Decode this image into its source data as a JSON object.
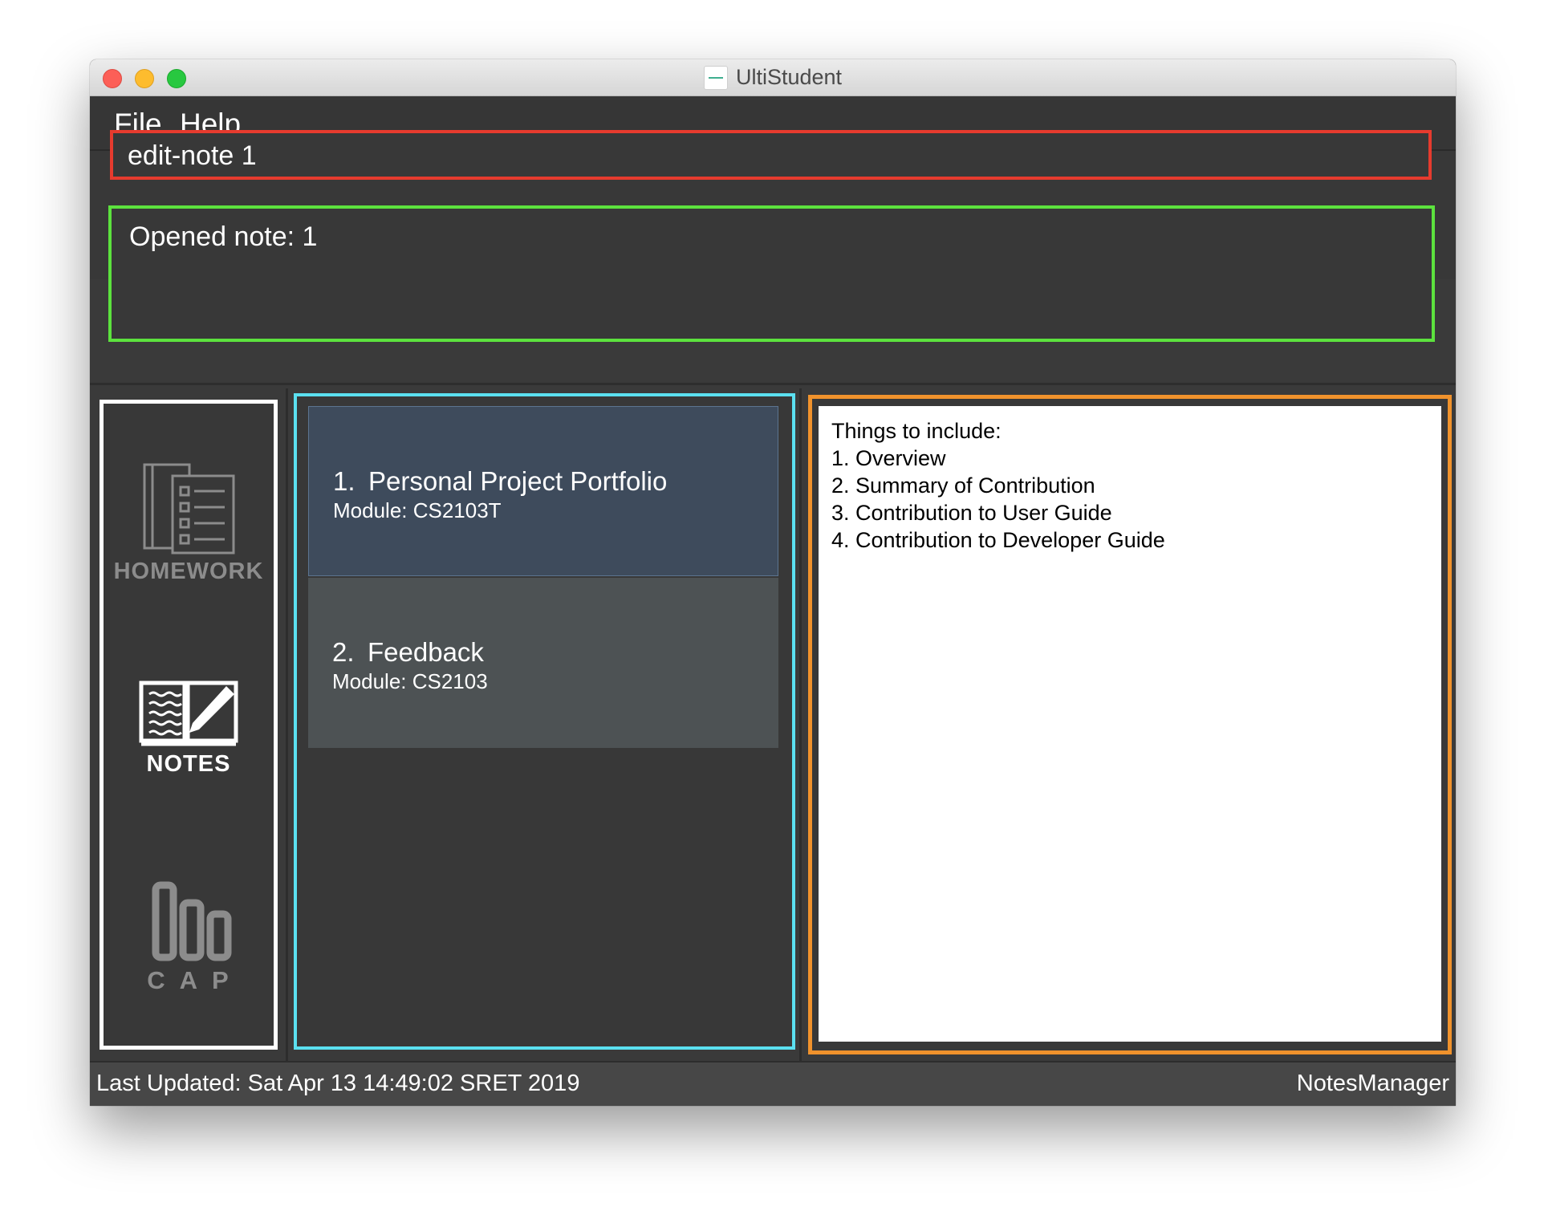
{
  "window": {
    "title": "UltiStudent"
  },
  "menu": {
    "file": "File",
    "help": "Help"
  },
  "command": {
    "value": "edit-note 1"
  },
  "result": {
    "message": "Opened note: 1"
  },
  "sidebar": {
    "items": [
      {
        "label": "HOMEWORK",
        "icon": "homework-icon",
        "active": false
      },
      {
        "label": "NOTES",
        "icon": "notes-icon",
        "active": true
      },
      {
        "label": "CAP",
        "icon": "cap-icon",
        "active": false
      }
    ]
  },
  "notes": [
    {
      "index": "1.",
      "title": "Personal Project Portfolio",
      "module": "Module: CS2103T",
      "selected": true
    },
    {
      "index": "2.",
      "title": "Feedback",
      "module": "Module: CS2103",
      "selected": false
    }
  ],
  "detail": {
    "lines": [
      "Things to include:",
      "1. Overview",
      "2. Summary of Contribution",
      "3. Contribution to User Guide",
      "4. Contribution to Developer Guide"
    ]
  },
  "status": {
    "last_updated": "Last Updated: Sat Apr 13 14:49:02 SRET 2019",
    "manager": "NotesManager"
  },
  "colors": {
    "command_border": "#e63b2e",
    "result_border": "#5ce23e",
    "sidebar_border": "#ffffff",
    "list_border": "#5be0f0",
    "detail_border": "#f0922c",
    "selected_card": "#3e4b5c",
    "card": "#4d5254",
    "background": "#383838"
  }
}
